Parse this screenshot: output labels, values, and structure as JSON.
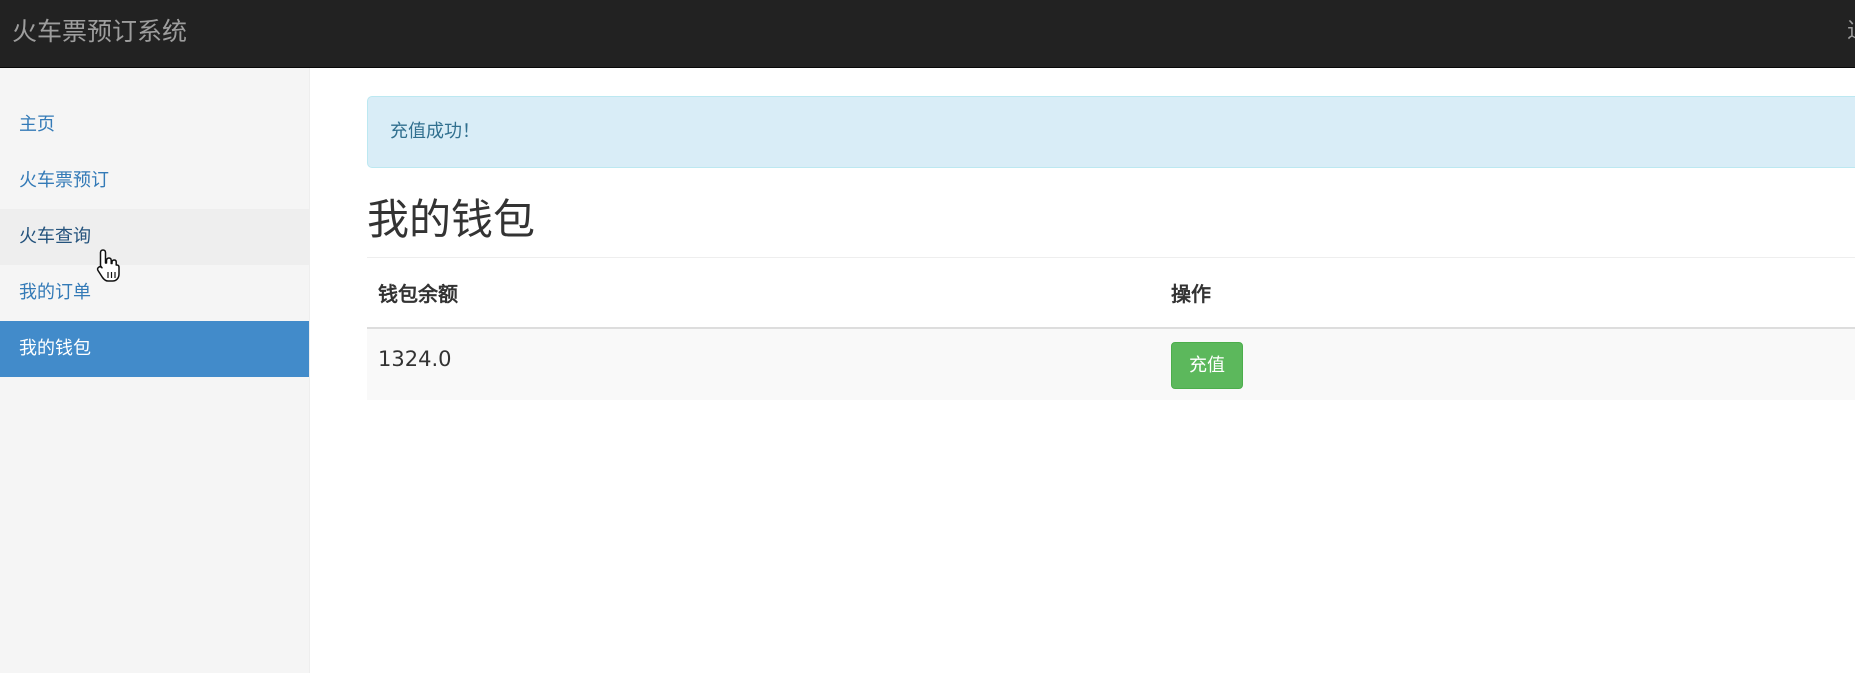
{
  "header": {
    "brand": "火车票预订系统",
    "right_fragment": "退"
  },
  "sidebar": {
    "items": [
      {
        "label": "主页"
      },
      {
        "label": "火车票预订"
      },
      {
        "label": "火车查询"
      },
      {
        "label": "我的订单"
      },
      {
        "label": "我的钱包"
      }
    ],
    "active_index": 4,
    "hover_index": 2
  },
  "main": {
    "alert": "充值成功！",
    "title": "我的钱包",
    "table": {
      "headers": [
        "钱包余额",
        "操作"
      ],
      "rows": [
        {
          "balance": "1324.0",
          "action_label": "充值"
        }
      ]
    }
  },
  "colors": {
    "navbar": "#222222",
    "active": "#428bca",
    "link": "#337ab7",
    "alert_bg": "#d9edf7",
    "success": "#5cb85c"
  }
}
